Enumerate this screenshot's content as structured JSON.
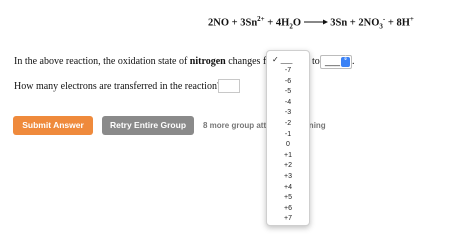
{
  "equation": {
    "r1": "2NO + 3Sn",
    "r1_sup": "2+",
    "r2": "+ 4H",
    "r2_sub": "2",
    "r2_tail": "O",
    "p1": "3Sn + 2NO",
    "p1_sub": "3",
    "p1_sup": "-",
    "p2": "+ 8H",
    "p2_sup": "+"
  },
  "question1": {
    "prefix": "In the above reaction, the oxidation state of ",
    "element": "nitrogen",
    "suffix": " changes fror",
    "to_label": "to",
    "select2_value": "___",
    "select2_stepper": "⇕",
    "period": "."
  },
  "question2": {
    "text": "How many electrons are transferred in the reaction?",
    "answer_value": ""
  },
  "buttons": {
    "submit": "Submit Answer",
    "retry": "Retry Entire Group"
  },
  "group_status": {
    "left": "8 more group atte",
    "right": "ining"
  },
  "dropdown": {
    "selected": "___",
    "check": "✓",
    "options": [
      "-7",
      "-6",
      "-5",
      "-4",
      "-3",
      "-2",
      "-1",
      "0",
      "+1",
      "+2",
      "+3",
      "+4",
      "+5",
      "+6",
      "+7"
    ]
  }
}
